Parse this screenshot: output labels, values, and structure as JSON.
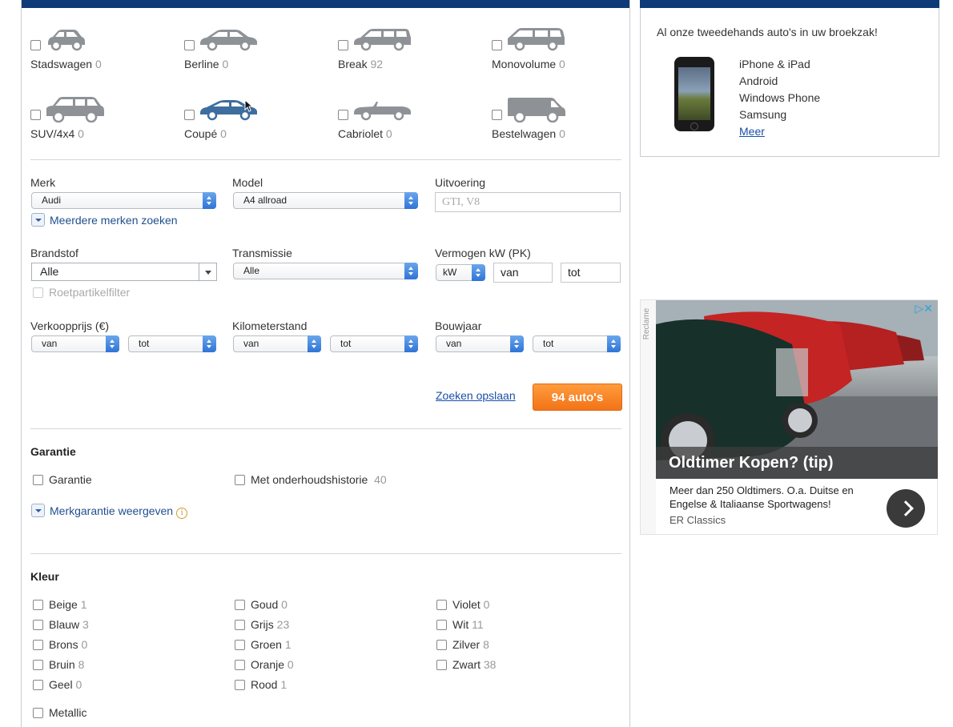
{
  "body_types": [
    {
      "label": "Stadswagen",
      "count": "0",
      "icon": "city-car-icon"
    },
    {
      "label": "Berline",
      "count": "0",
      "icon": "sedan-icon"
    },
    {
      "label": "Break",
      "count": "92",
      "icon": "station-wagon-icon"
    },
    {
      "label": "Monovolume",
      "count": "0",
      "icon": "minivan-icon"
    },
    {
      "label": "SUV/4x4",
      "count": "0",
      "icon": "suv-icon"
    },
    {
      "label": "Coupé",
      "count": "0",
      "icon": "coupe-icon"
    },
    {
      "label": "Cabriolet",
      "count": "0",
      "icon": "convertible-icon"
    },
    {
      "label": "Bestelwagen",
      "count": "0",
      "icon": "van-icon"
    }
  ],
  "filters": {
    "merk": {
      "label": "Merk",
      "value": "Audi"
    },
    "model": {
      "label": "Model",
      "value": "A4 allroad"
    },
    "uitvoering": {
      "label": "Uitvoering",
      "placeholder": "GTI, V8"
    },
    "more_brands": "Meerdere merken zoeken",
    "brandstof": {
      "label": "Brandstof",
      "value": "Alle"
    },
    "transmissie": {
      "label": "Transmissie",
      "value": "Alle"
    },
    "vermogen": {
      "label": "Vermogen kW (PK)",
      "unit": "kW",
      "from": "van",
      "to": "tot"
    },
    "roetfilter": "Roetpartikelfilter",
    "prijs": {
      "label": "Verkoopprijs (€)",
      "from": "van",
      "to": "tot"
    },
    "km": {
      "label": "Kilometerstand",
      "from": "van",
      "to": "tot"
    },
    "bouwjaar": {
      "label": "Bouwjaar",
      "from": "van",
      "to": "tot"
    }
  },
  "actions": {
    "save": "Zoeken opslaan",
    "results": "94 auto's"
  },
  "garantie": {
    "title": "Garantie",
    "option1": "Garantie",
    "option2": "Met onderhoudshistorie",
    "option2_count": "40",
    "expander": "Merkgarantie weergeven",
    "info_glyph": "i"
  },
  "kleur": {
    "title": "Kleur",
    "colors": [
      {
        "label": "Beige",
        "count": "1"
      },
      {
        "label": "Blauw",
        "count": "3"
      },
      {
        "label": "Brons",
        "count": "0"
      },
      {
        "label": "Bruin",
        "count": "8"
      },
      {
        "label": "Geel",
        "count": "0"
      },
      {
        "label": "Goud",
        "count": "0"
      },
      {
        "label": "Grijs",
        "count": "23"
      },
      {
        "label": "Groen",
        "count": "1"
      },
      {
        "label": "Oranje",
        "count": "0"
      },
      {
        "label": "Rood",
        "count": "1"
      },
      {
        "label": "Violet",
        "count": "0"
      },
      {
        "label": "Wit",
        "count": "11"
      },
      {
        "label": "Zilver",
        "count": "8"
      },
      {
        "label": "Zwart",
        "count": "38"
      }
    ],
    "metallic": "Metallic"
  },
  "app_promo": {
    "intro": "Al onze tweedehands auto's in uw broekzak!",
    "platforms": [
      "iPhone & iPad",
      "Android",
      "Windows Phone",
      "Samsung"
    ],
    "more": "Meer"
  },
  "ad": {
    "side_label": "Reclame",
    "choices": "▷✕",
    "headline": "Oldtimer Kopen? (tip)",
    "description": "Meer dan 250 Oldtimers. O.a. Duitse en Engelse & Italiaanse Sportwagens!",
    "source": "ER Classics"
  },
  "colors": {
    "header": "#0e3a78",
    "cta": "#f27317",
    "link": "#1a4fa6",
    "car_icon": "#8e9297",
    "car_icon_active": "#3e6d9f"
  }
}
